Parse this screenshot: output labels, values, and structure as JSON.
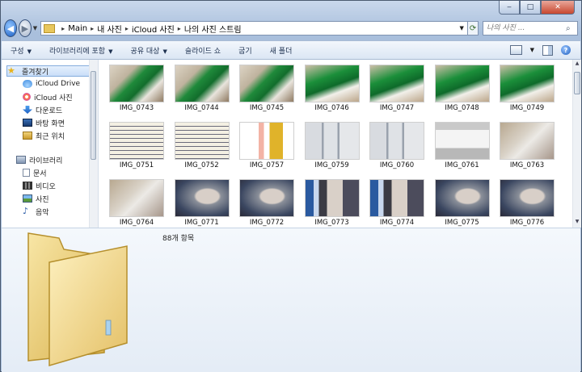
{
  "window": {
    "minimize_glyph": "‒",
    "maximize_glyph": "□",
    "close_glyph": "✕"
  },
  "nav": {
    "breadcrumb": [
      "Main",
      "내 사진",
      "iCloud 사진",
      "나의 사진 스트림"
    ],
    "search_placeholder": "나의 사진 ..."
  },
  "toolbar": {
    "organize": "구성",
    "include_library": "라이브러리에 포함",
    "share": "공유 대상",
    "slideshow": "슬라이드 쇼",
    "burn": "굽기",
    "new_folder": "새 폴더"
  },
  "sidebar": {
    "favorites": "즐겨찾기",
    "favorite_items": [
      "iCloud Drive",
      "iCloud 사진",
      "다운로드",
      "바탕 화면",
      "최근 위치"
    ],
    "libraries": "라이브러리",
    "library_items": [
      "문서",
      "비디오",
      "사진",
      "음악"
    ]
  },
  "files": [
    {
      "name": "IMG_0743",
      "thumb": "t-green"
    },
    {
      "name": "IMG_0744",
      "thumb": "t-green"
    },
    {
      "name": "IMG_0745",
      "thumb": "t-green"
    },
    {
      "name": "IMG_0746",
      "thumb": "t-green2"
    },
    {
      "name": "IMG_0747",
      "thumb": "t-green2"
    },
    {
      "name": "IMG_0748",
      "thumb": "t-green2"
    },
    {
      "name": "IMG_0749",
      "thumb": "t-green2"
    },
    {
      "name": "IMG_0751",
      "thumb": "t-paper"
    },
    {
      "name": "IMG_0752",
      "thumb": "t-paper"
    },
    {
      "name": "IMG_0757",
      "thumb": "t-chart"
    },
    {
      "name": "IMG_0759",
      "thumb": "t-rack"
    },
    {
      "name": "IMG_0760",
      "thumb": "t-rack"
    },
    {
      "name": "IMG_0761",
      "thumb": "t-red"
    },
    {
      "name": "IMG_0763",
      "thumb": "t-cloth"
    },
    {
      "name": "IMG_0764",
      "thumb": "t-cloth"
    },
    {
      "name": "IMG_0771",
      "thumb": "t-face"
    },
    {
      "name": "IMG_0772",
      "thumb": "t-face"
    },
    {
      "name": "IMG_0773",
      "thumb": "t-shelf"
    },
    {
      "name": "IMG_0774",
      "thumb": "t-shelf"
    },
    {
      "name": "IMG_0775",
      "thumb": "t-face"
    },
    {
      "name": "IMG_0776",
      "thumb": "t-face"
    }
  ],
  "status": {
    "item_count": "88개 항목"
  }
}
